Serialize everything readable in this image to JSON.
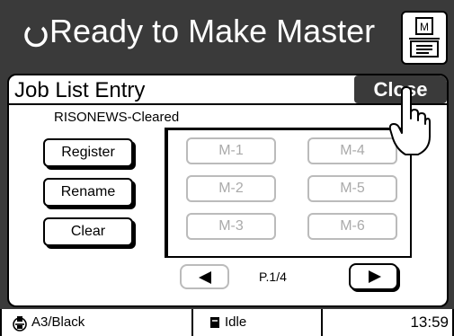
{
  "header": {
    "title": "Ready to Make Master",
    "status_icon": "ready-circle-icon",
    "master_button_icon": "master-document-icon"
  },
  "panel": {
    "title": "Job List Entry",
    "close_label": "Close",
    "file_name": "RISONEWS-Cleared",
    "actions": {
      "register": "Register",
      "rename": "Rename",
      "clear": "Clear"
    },
    "slots": [
      "M-1",
      "M-2",
      "M-3",
      "M-4",
      "M-5",
      "M-6"
    ],
    "page_indicator": "P.1/4",
    "prev_icon": "triangle-left-icon",
    "next_icon": "triangle-right-icon"
  },
  "status_bar": {
    "paper": "A3/Black",
    "state": "Idle",
    "time": "13:59"
  },
  "colors": {
    "header_bg": "#3a3a3a",
    "close_bg": "#3a3a3a",
    "disabled_text": "#aaaaaa",
    "disabled_border": "#bbbbbb"
  }
}
